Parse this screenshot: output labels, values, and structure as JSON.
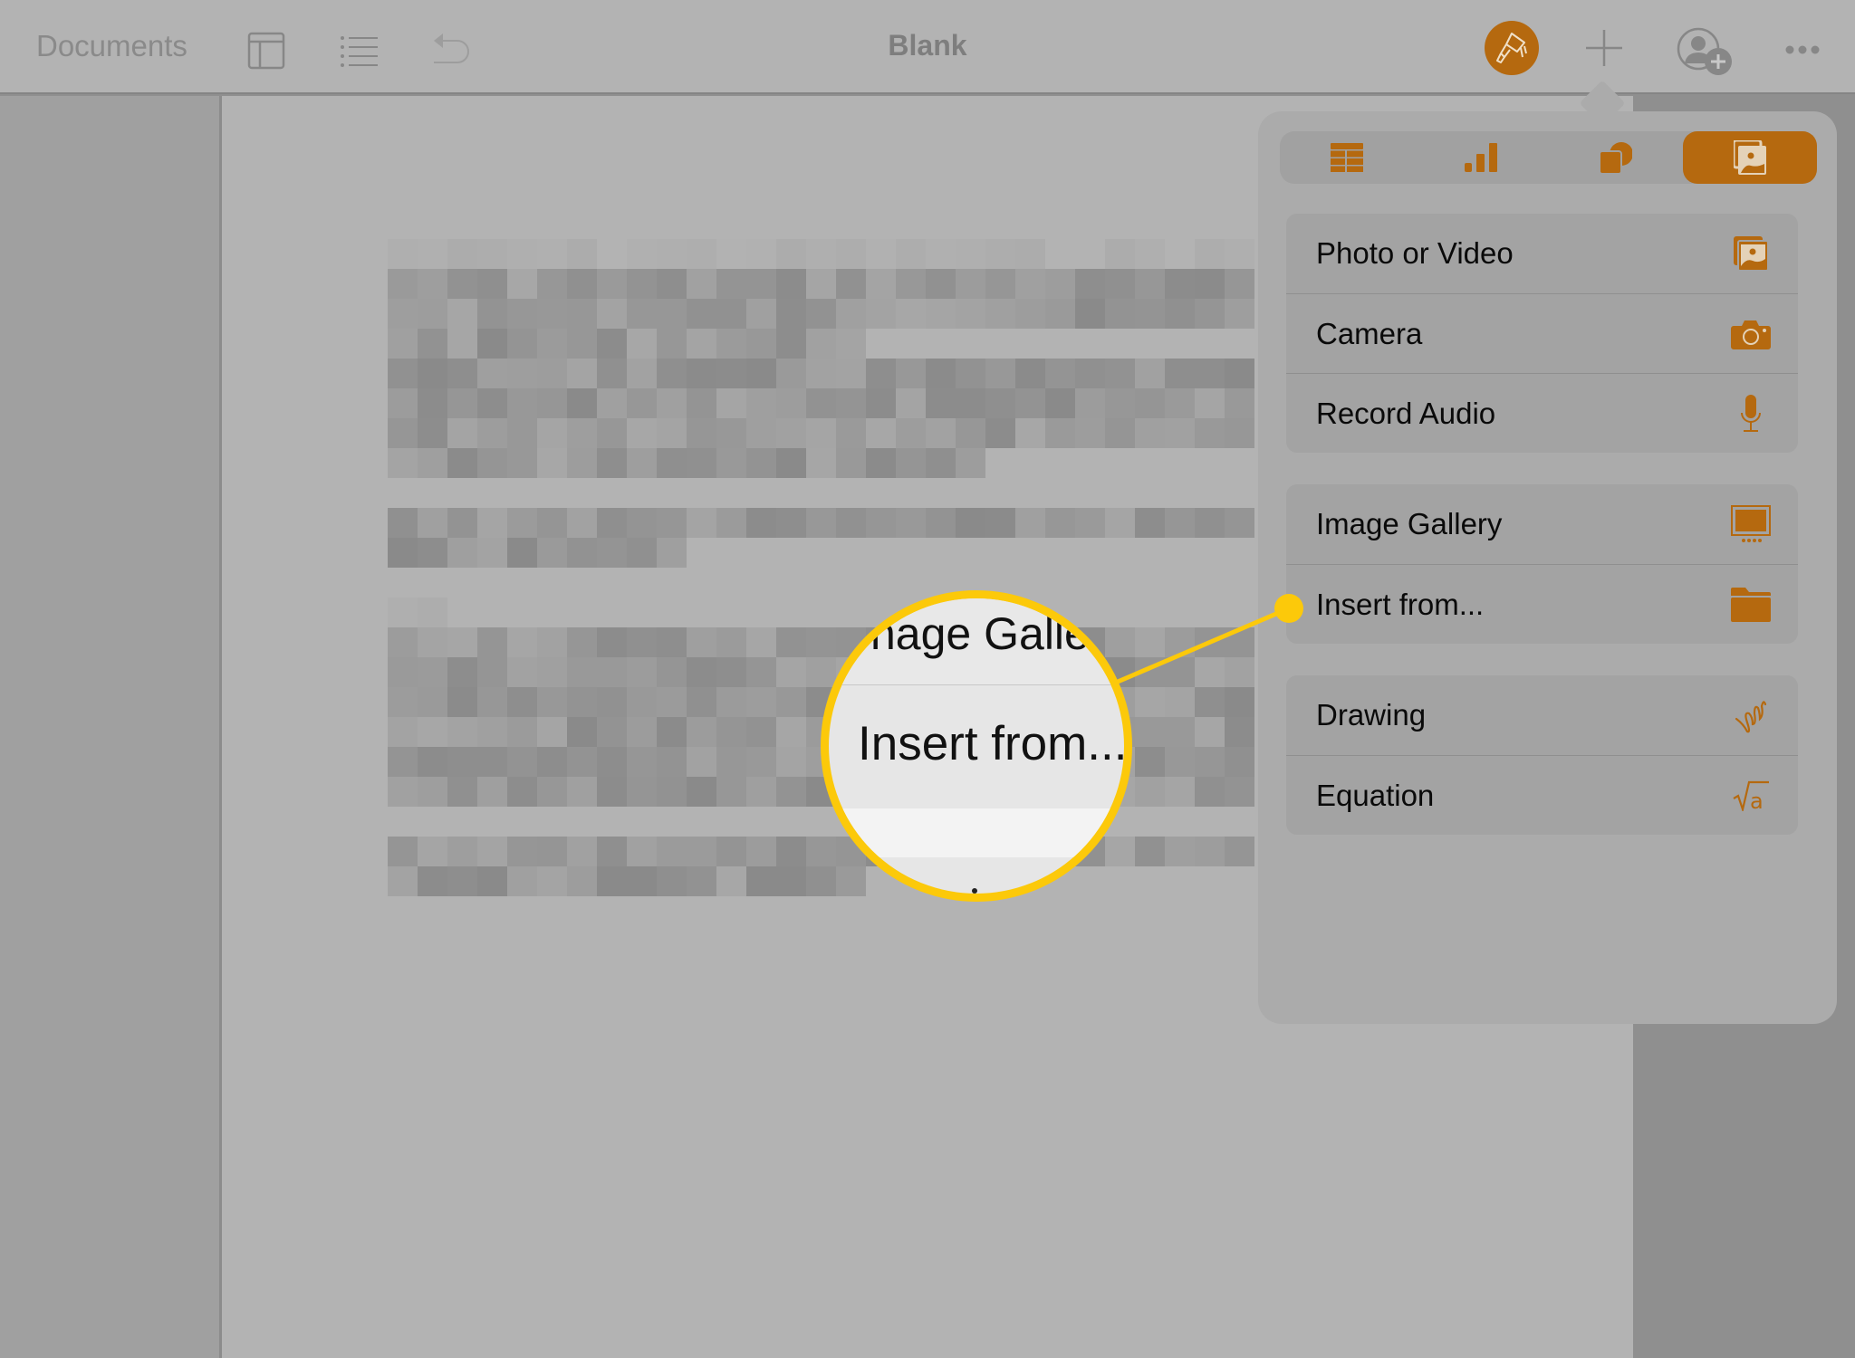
{
  "toolbar": {
    "documents_label": "Documents",
    "title": "Blank",
    "left_icons": [
      "view-options-icon",
      "list-icon",
      "undo-icon"
    ],
    "right_icons": [
      "format-brush-icon",
      "insert-plus-icon",
      "collaborate-icon",
      "more-icon"
    ]
  },
  "popover": {
    "tabs": [
      {
        "name": "table",
        "icon": "table-icon",
        "active": false
      },
      {
        "name": "chart",
        "icon": "chart-icon",
        "active": false
      },
      {
        "name": "shape",
        "icon": "shape-icon",
        "active": false
      },
      {
        "name": "media",
        "icon": "media-icon",
        "active": true
      }
    ],
    "groups": [
      {
        "items": [
          {
            "label": "Photo or Video",
            "icon": "photo-icon"
          },
          {
            "label": "Camera",
            "icon": "camera-icon"
          },
          {
            "label": "Record Audio",
            "icon": "microphone-icon"
          }
        ]
      },
      {
        "items": [
          {
            "label": "Image Gallery",
            "icon": "image-gallery-icon"
          },
          {
            "label": "Insert from...",
            "icon": "folder-icon"
          }
        ]
      },
      {
        "items": [
          {
            "label": "Drawing",
            "icon": "drawing-icon"
          },
          {
            "label": "Equation",
            "icon": "equation-icon"
          }
        ]
      }
    ]
  },
  "callout": {
    "top_text": "nage Galle",
    "main_text": "Insert from...",
    "highlight_target": "Insert from..."
  },
  "colors": {
    "accent": "#b5690f",
    "callout": "#fcc90a"
  }
}
